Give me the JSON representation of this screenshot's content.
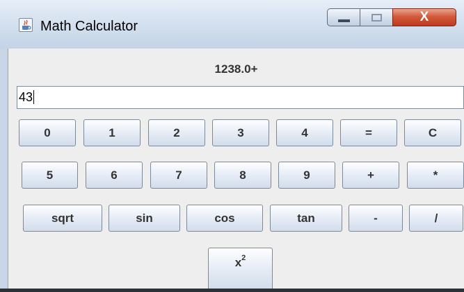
{
  "window": {
    "title": "Math Calculator",
    "app_icon": "java-cup-icon",
    "controls": {
      "minimize_icon": "minimize-icon",
      "maximize_icon": "maximize-icon",
      "close_label": "X"
    }
  },
  "display": {
    "expression": "1238.0+",
    "input_value": "43"
  },
  "keys": {
    "row1": [
      "0",
      "1",
      "2",
      "3",
      "4",
      "=",
      "C"
    ],
    "row2": [
      "5",
      "6",
      "7",
      "8",
      "9",
      "+",
      "*"
    ],
    "row3": [
      "sqrt",
      "sin",
      "cos",
      "tan",
      "-",
      "/"
    ],
    "square_base": "x",
    "square_exp": "2"
  },
  "colors": {
    "window_frame": "#c9d6e6",
    "panel_background": "#eeeeee",
    "button_text": "#333333",
    "close_button": "#d35a3c"
  }
}
